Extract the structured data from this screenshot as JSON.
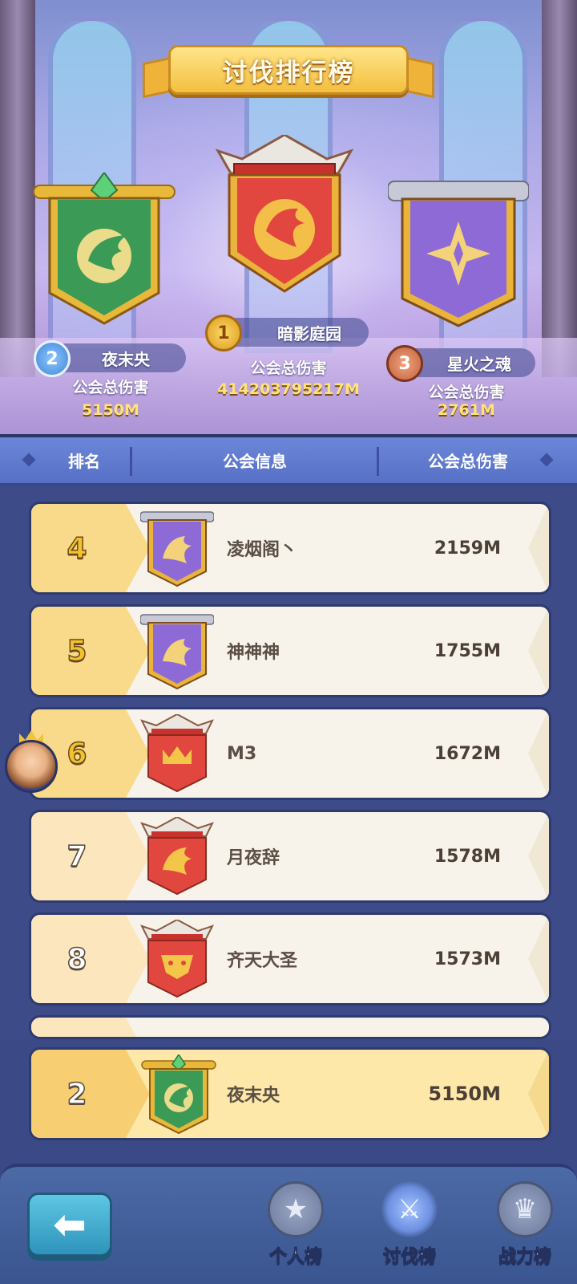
{
  "title": "讨伐排行榜",
  "colors": {
    "gold": "#f2c32c",
    "header_blue": "#5670c6",
    "row_bg": "#f7f3ea",
    "own_row_bg": "#fde8a9",
    "banner_red": "#e0473e",
    "banner_purple": "#8d6ad6",
    "banner_green": "#3b9a55"
  },
  "podium": {
    "first": {
      "rank": "1",
      "name": "暗影庭园",
      "stat_label": "公会总伤害",
      "damage": "414203795217M",
      "banner": "red-eagle-banner"
    },
    "second": {
      "rank": "2",
      "name": "夜末央",
      "stat_label": "公会总伤害",
      "damage": "5150M",
      "banner": "green-wing-banner"
    },
    "third": {
      "rank": "3",
      "name": "星火之魂",
      "stat_label": "公会总伤害",
      "damage": "2761M",
      "banner": "purple-star-banner"
    }
  },
  "table_header": {
    "rank": "排名",
    "guild_info": "公会信息",
    "total_damage": "公会总伤害"
  },
  "rows": [
    {
      "rank": "4",
      "name": "凌烟阁丶",
      "damage": "2159M",
      "banner": "purple-dragon-banner"
    },
    {
      "rank": "5",
      "name": "神神神",
      "damage": "1755M",
      "banner": "purple-dragon-banner"
    },
    {
      "rank": "6",
      "name": "M3",
      "damage": "1672M",
      "banner": "red-crown-banner"
    },
    {
      "rank": "7",
      "name": "月夜辞",
      "damage": "1578M",
      "banner": "red-dragon-banner"
    },
    {
      "rank": "8",
      "name": "齐天大圣",
      "damage": "1573M",
      "banner": "red-beast-banner"
    }
  ],
  "own_guild": {
    "rank": "2",
    "name": "夜末央",
    "damage": "5150M",
    "banner": "green-wing-banner"
  },
  "nav": {
    "back_icon": "back-arrow-icon",
    "tabs": [
      {
        "label": "个人榜",
        "icon": "star-medal-icon",
        "active": false
      },
      {
        "label": "讨伐榜",
        "icon": "crossed-swords-icon",
        "active": true
      },
      {
        "label": "战力榜",
        "icon": "crown-shield-icon",
        "active": false
      }
    ]
  }
}
